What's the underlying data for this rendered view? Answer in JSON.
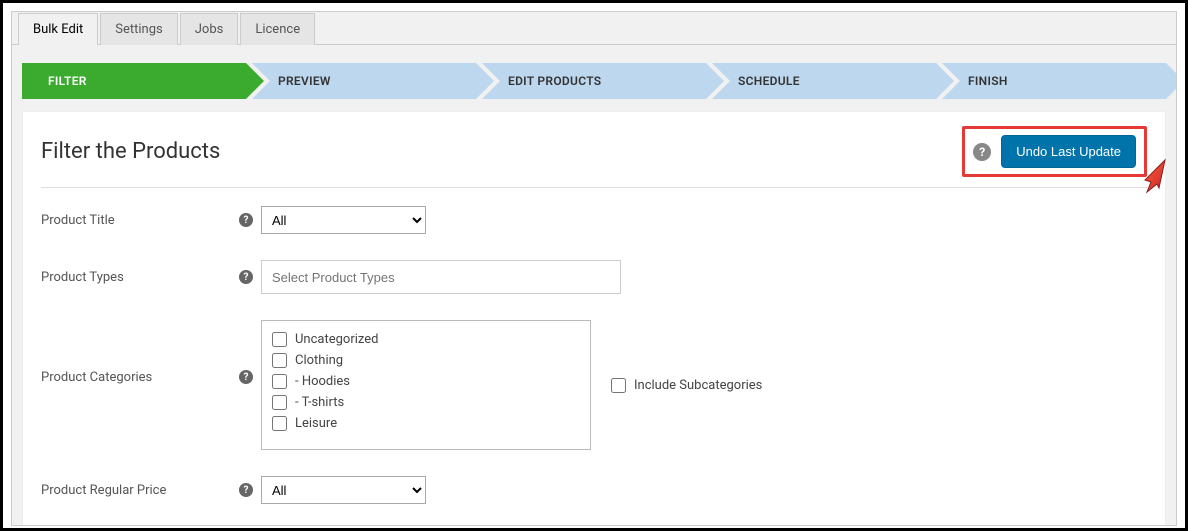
{
  "tabs": [
    {
      "label": "Bulk Edit",
      "active": true
    },
    {
      "label": "Settings",
      "active": false
    },
    {
      "label": "Jobs",
      "active": false
    },
    {
      "label": "Licence",
      "active": false
    }
  ],
  "steps": [
    {
      "label": "FILTER",
      "active": true
    },
    {
      "label": "PREVIEW",
      "active": false
    },
    {
      "label": "EDIT PRODUCTS",
      "active": false
    },
    {
      "label": "SCHEDULE",
      "active": false
    },
    {
      "label": "FINISH",
      "active": false
    }
  ],
  "panel": {
    "title": "Filter the Products",
    "undo_label": "Undo Last Update"
  },
  "form": {
    "title": {
      "label": "Product Title",
      "selected": "All"
    },
    "types": {
      "label": "Product Types",
      "placeholder": "Select Product Types"
    },
    "categories": {
      "label": "Product Categories",
      "include_sub_label": "Include Subcategories",
      "items": [
        "Uncategorized",
        "Clothing",
        " - Hoodies",
        " - T-shirts",
        "Leisure"
      ]
    },
    "regular_price": {
      "label": "Product Regular Price",
      "selected": "All"
    }
  }
}
